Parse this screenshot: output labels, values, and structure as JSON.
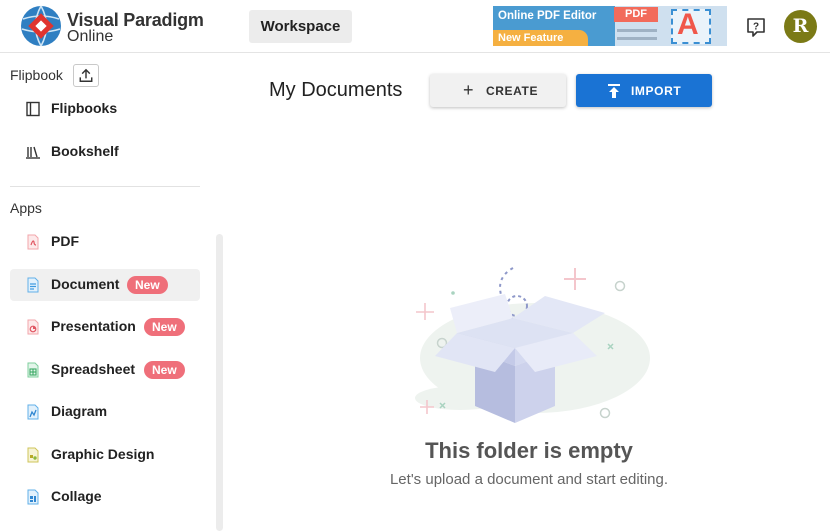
{
  "header": {
    "logo_name": "Visual Paradigm",
    "logo_sub": "Online",
    "workspace_label": "Workspace",
    "banner": {
      "title": "Online PDF Editor",
      "tag": "New Feature",
      "pdf_label": "PDF",
      "letter": "A"
    },
    "help_icon": "help-question-icon",
    "avatar_initial": "R",
    "avatar_color": "#7b7a16"
  },
  "sidebar": {
    "flipbook_section": {
      "title": "Flipbook",
      "items": [
        {
          "label": "Flipbooks",
          "icon": "flipbook-icon"
        },
        {
          "label": "Bookshelf",
          "icon": "bookshelf-icon"
        }
      ]
    },
    "apps_section": {
      "title": "Apps",
      "items": [
        {
          "label": "PDF",
          "icon": "pdf-icon",
          "badge": ""
        },
        {
          "label": "Document",
          "icon": "document-icon",
          "badge": "New",
          "active": true
        },
        {
          "label": "Presentation",
          "icon": "presentation-icon",
          "badge": "New"
        },
        {
          "label": "Spreadsheet",
          "icon": "spreadsheet-icon",
          "badge": "New"
        },
        {
          "label": "Diagram",
          "icon": "diagram-icon",
          "badge": ""
        },
        {
          "label": "Graphic Design",
          "icon": "graphic-design-icon",
          "badge": ""
        },
        {
          "label": "Collage",
          "icon": "collage-icon",
          "badge": ""
        }
      ]
    }
  },
  "main": {
    "title": "My Documents",
    "create_label": "CREATE",
    "import_label": "IMPORT",
    "empty_title": "This folder is empty",
    "empty_subtitle": "Let's upload a document and start editing."
  },
  "colors": {
    "accent": "#1a73d4",
    "badge": "#ef6f7a",
    "banner_blue": "#4a9bd1",
    "banner_orange": "#f5b041"
  }
}
